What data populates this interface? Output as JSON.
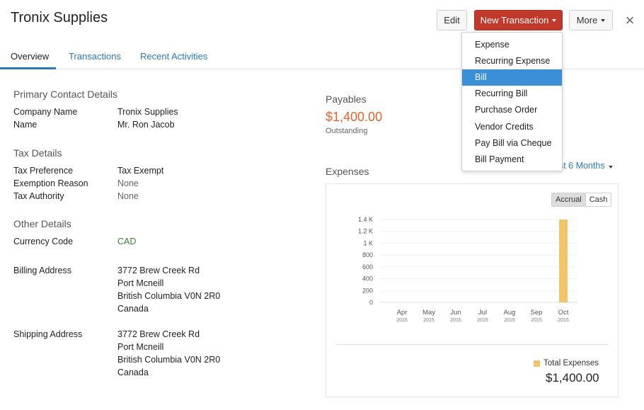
{
  "header": {
    "title": "Tronix Supplies",
    "edit_label": "Edit",
    "new_transaction_label": "New Transaction",
    "more_label": "More",
    "close_glyph": "×"
  },
  "tabs": [
    {
      "label": "Overview",
      "active": true
    },
    {
      "label": "Transactions",
      "active": false
    },
    {
      "label": "Recent Activities",
      "active": false
    }
  ],
  "primary_contact": {
    "heading": "Primary Contact Details",
    "company_label": "Company Name",
    "company_value": "Tronix Supplies",
    "name_label": "Name",
    "name_value": "Mr. Ron Jacob"
  },
  "tax": {
    "heading": "Tax Details",
    "preference_label": "Tax Preference",
    "preference_value": "Tax Exempt",
    "exemption_label": "Exemption Reason",
    "exemption_value": "None",
    "authority_label": "Tax Authority",
    "authority_value": "None"
  },
  "other": {
    "heading": "Other Details",
    "currency_label": "Currency Code",
    "currency_value": "CAD",
    "billing_label": "Billing Address",
    "billing_lines": [
      "3772 Brew Creek Rd",
      "Port Mcneill",
      "British Columbia V0N 2R0",
      "Canada"
    ],
    "shipping_label": "Shipping Address",
    "shipping_lines": [
      "3772 Brew Creek Rd",
      "Port Mcneill",
      "British Columbia V0N 2R0",
      "Canada"
    ]
  },
  "payables": {
    "heading": "Payables",
    "amount": "$1,400.00",
    "status": "Outstanding"
  },
  "expenses": {
    "heading": "Expenses",
    "period_label": "ast 6 Months",
    "toggle_accrual": "Accrual",
    "toggle_cash": "Cash",
    "legend_label": "Total Expenses",
    "total": "$1,400.00"
  },
  "chart_data": {
    "type": "bar",
    "categories": [
      "Apr",
      "May",
      "Jun",
      "Jul",
      "Aug",
      "Sep",
      "Oct"
    ],
    "years": [
      "2015",
      "2015",
      "2015",
      "2015",
      "2015",
      "2015",
      "2015"
    ],
    "values": [
      0,
      0,
      0,
      0,
      0,
      0,
      1400
    ],
    "yticks": [
      "0",
      "200",
      "400",
      "600",
      "800",
      "1 K",
      "1.2 K",
      "1.4 K"
    ],
    "ylim": [
      0,
      1400
    ],
    "bar_color": "#f2c56b"
  },
  "dropdown": {
    "items": [
      "Expense",
      "Recurring Expense",
      "Bill",
      "Recurring Bill",
      "Purchase Order",
      "Vendor Credits",
      "Pay Bill via Cheque",
      "Bill Payment"
    ],
    "selected": "Bill"
  },
  "colors": {
    "accent": "#2a7ab8",
    "primary_button": "#c0392b",
    "payables_amount": "#e8622c",
    "menu_selected": "#3a8fd6"
  }
}
